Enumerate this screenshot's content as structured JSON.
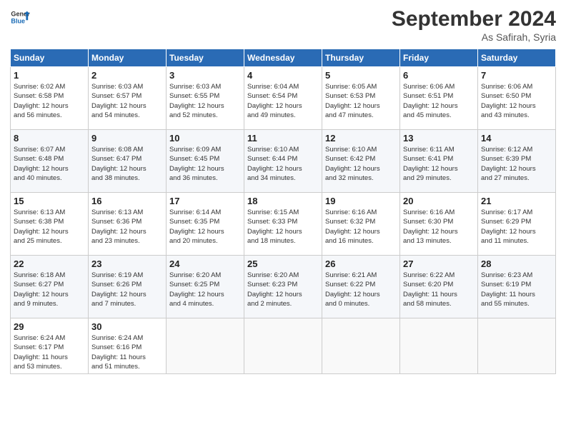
{
  "logo": {
    "line1": "General",
    "line2": "Blue"
  },
  "title": "September 2024",
  "location": "As Safirah, Syria",
  "weekdays": [
    "Sunday",
    "Monday",
    "Tuesday",
    "Wednesday",
    "Thursday",
    "Friday",
    "Saturday"
  ],
  "weeks": [
    [
      {
        "day": "1",
        "rise": "6:02 AM",
        "set": "6:58 PM",
        "hours": "12 hours",
        "mins": "56"
      },
      {
        "day": "2",
        "rise": "6:03 AM",
        "set": "6:57 PM",
        "hours": "12 hours",
        "mins": "54"
      },
      {
        "day": "3",
        "rise": "6:03 AM",
        "set": "6:55 PM",
        "hours": "12 hours",
        "mins": "52"
      },
      {
        "day": "4",
        "rise": "6:04 AM",
        "set": "6:54 PM",
        "hours": "12 hours",
        "mins": "49"
      },
      {
        "day": "5",
        "rise": "6:05 AM",
        "set": "6:53 PM",
        "hours": "12 hours",
        "mins": "47"
      },
      {
        "day": "6",
        "rise": "6:06 AM",
        "set": "6:51 PM",
        "hours": "12 hours",
        "mins": "45"
      },
      {
        "day": "7",
        "rise": "6:06 AM",
        "set": "6:50 PM",
        "hours": "12 hours",
        "mins": "43"
      }
    ],
    [
      {
        "day": "8",
        "rise": "6:07 AM",
        "set": "6:48 PM",
        "hours": "12 hours",
        "mins": "40"
      },
      {
        "day": "9",
        "rise": "6:08 AM",
        "set": "6:47 PM",
        "hours": "12 hours",
        "mins": "38"
      },
      {
        "day": "10",
        "rise": "6:09 AM",
        "set": "6:45 PM",
        "hours": "12 hours",
        "mins": "36"
      },
      {
        "day": "11",
        "rise": "6:10 AM",
        "set": "6:44 PM",
        "hours": "12 hours",
        "mins": "34"
      },
      {
        "day": "12",
        "rise": "6:10 AM",
        "set": "6:42 PM",
        "hours": "12 hours",
        "mins": "32"
      },
      {
        "day": "13",
        "rise": "6:11 AM",
        "set": "6:41 PM",
        "hours": "12 hours",
        "mins": "29"
      },
      {
        "day": "14",
        "rise": "6:12 AM",
        "set": "6:39 PM",
        "hours": "12 hours",
        "mins": "27"
      }
    ],
    [
      {
        "day": "15",
        "rise": "6:13 AM",
        "set": "6:38 PM",
        "hours": "12 hours",
        "mins": "25"
      },
      {
        "day": "16",
        "rise": "6:13 AM",
        "set": "6:36 PM",
        "hours": "12 hours",
        "mins": "23"
      },
      {
        "day": "17",
        "rise": "6:14 AM",
        "set": "6:35 PM",
        "hours": "12 hours",
        "mins": "20"
      },
      {
        "day": "18",
        "rise": "6:15 AM",
        "set": "6:33 PM",
        "hours": "12 hours",
        "mins": "18"
      },
      {
        "day": "19",
        "rise": "6:16 AM",
        "set": "6:32 PM",
        "hours": "12 hours",
        "mins": "16"
      },
      {
        "day": "20",
        "rise": "6:16 AM",
        "set": "6:30 PM",
        "hours": "12 hours",
        "mins": "13"
      },
      {
        "day": "21",
        "rise": "6:17 AM",
        "set": "6:29 PM",
        "hours": "12 hours",
        "mins": "11"
      }
    ],
    [
      {
        "day": "22",
        "rise": "6:18 AM",
        "set": "6:27 PM",
        "hours": "12 hours",
        "mins": "9"
      },
      {
        "day": "23",
        "rise": "6:19 AM",
        "set": "6:26 PM",
        "hours": "12 hours",
        "mins": "7"
      },
      {
        "day": "24",
        "rise": "6:20 AM",
        "set": "6:25 PM",
        "hours": "12 hours",
        "mins": "4"
      },
      {
        "day": "25",
        "rise": "6:20 AM",
        "set": "6:23 PM",
        "hours": "12 hours",
        "mins": "2"
      },
      {
        "day": "26",
        "rise": "6:21 AM",
        "set": "6:22 PM",
        "hours": "12 hours",
        "mins": "0"
      },
      {
        "day": "27",
        "rise": "6:22 AM",
        "set": "6:20 PM",
        "hours": "11 hours",
        "mins": "58"
      },
      {
        "day": "28",
        "rise": "6:23 AM",
        "set": "6:19 PM",
        "hours": "11 hours",
        "mins": "55"
      }
    ],
    [
      {
        "day": "29",
        "rise": "6:24 AM",
        "set": "6:17 PM",
        "hours": "11 hours",
        "mins": "53"
      },
      {
        "day": "30",
        "rise": "6:24 AM",
        "set": "6:16 PM",
        "hours": "11 hours",
        "mins": "51"
      },
      null,
      null,
      null,
      null,
      null
    ]
  ]
}
